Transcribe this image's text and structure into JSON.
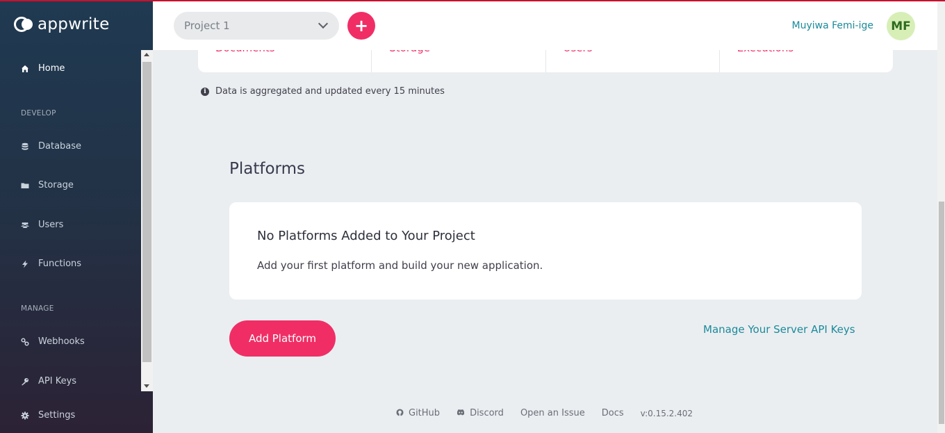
{
  "app": {
    "logo_text": "appwrite"
  },
  "sidebar": {
    "home": {
      "label": "Home",
      "icon": "home-icon"
    },
    "sections": {
      "develop": "DEVELOP",
      "manage": "MANAGE"
    },
    "items": [
      {
        "label": "Database",
        "icon": "database-icon"
      },
      {
        "label": "Storage",
        "icon": "folder-icon"
      },
      {
        "label": "Users",
        "icon": "users-icon"
      },
      {
        "label": "Functions",
        "icon": "bolt-icon"
      },
      {
        "label": "Webhooks",
        "icon": "link-icon"
      },
      {
        "label": "API Keys",
        "icon": "key-icon"
      },
      {
        "label": "Settings",
        "icon": "gear-icon"
      }
    ]
  },
  "header": {
    "project_select": "Project 1",
    "add_project_label": "+",
    "user_name": "Muyiwa Femi-ige",
    "avatar_initials": "MF"
  },
  "stats": [
    {
      "label": "Documents"
    },
    {
      "label": "Storage"
    },
    {
      "label": "Users"
    },
    {
      "label": "Executions"
    }
  ],
  "note": "Data is aggregated and updated every 15 minutes",
  "platforms": {
    "title": "Platforms",
    "empty_title": "No Platforms Added to Your Project",
    "empty_text": "Add your first platform and build your new application.",
    "add_button": "Add Platform",
    "manage_keys_link": "Manage Your Server API Keys"
  },
  "footer": {
    "github": "GitHub",
    "discord": "Discord",
    "issue": "Open an Issue",
    "docs": "Docs",
    "version": "v:0.15.2.402"
  },
  "colors": {
    "accent": "#f02e65",
    "link": "#1a8a9a",
    "sidebar_top": "#1f3a52",
    "sidebar_bottom": "#2c2235"
  }
}
